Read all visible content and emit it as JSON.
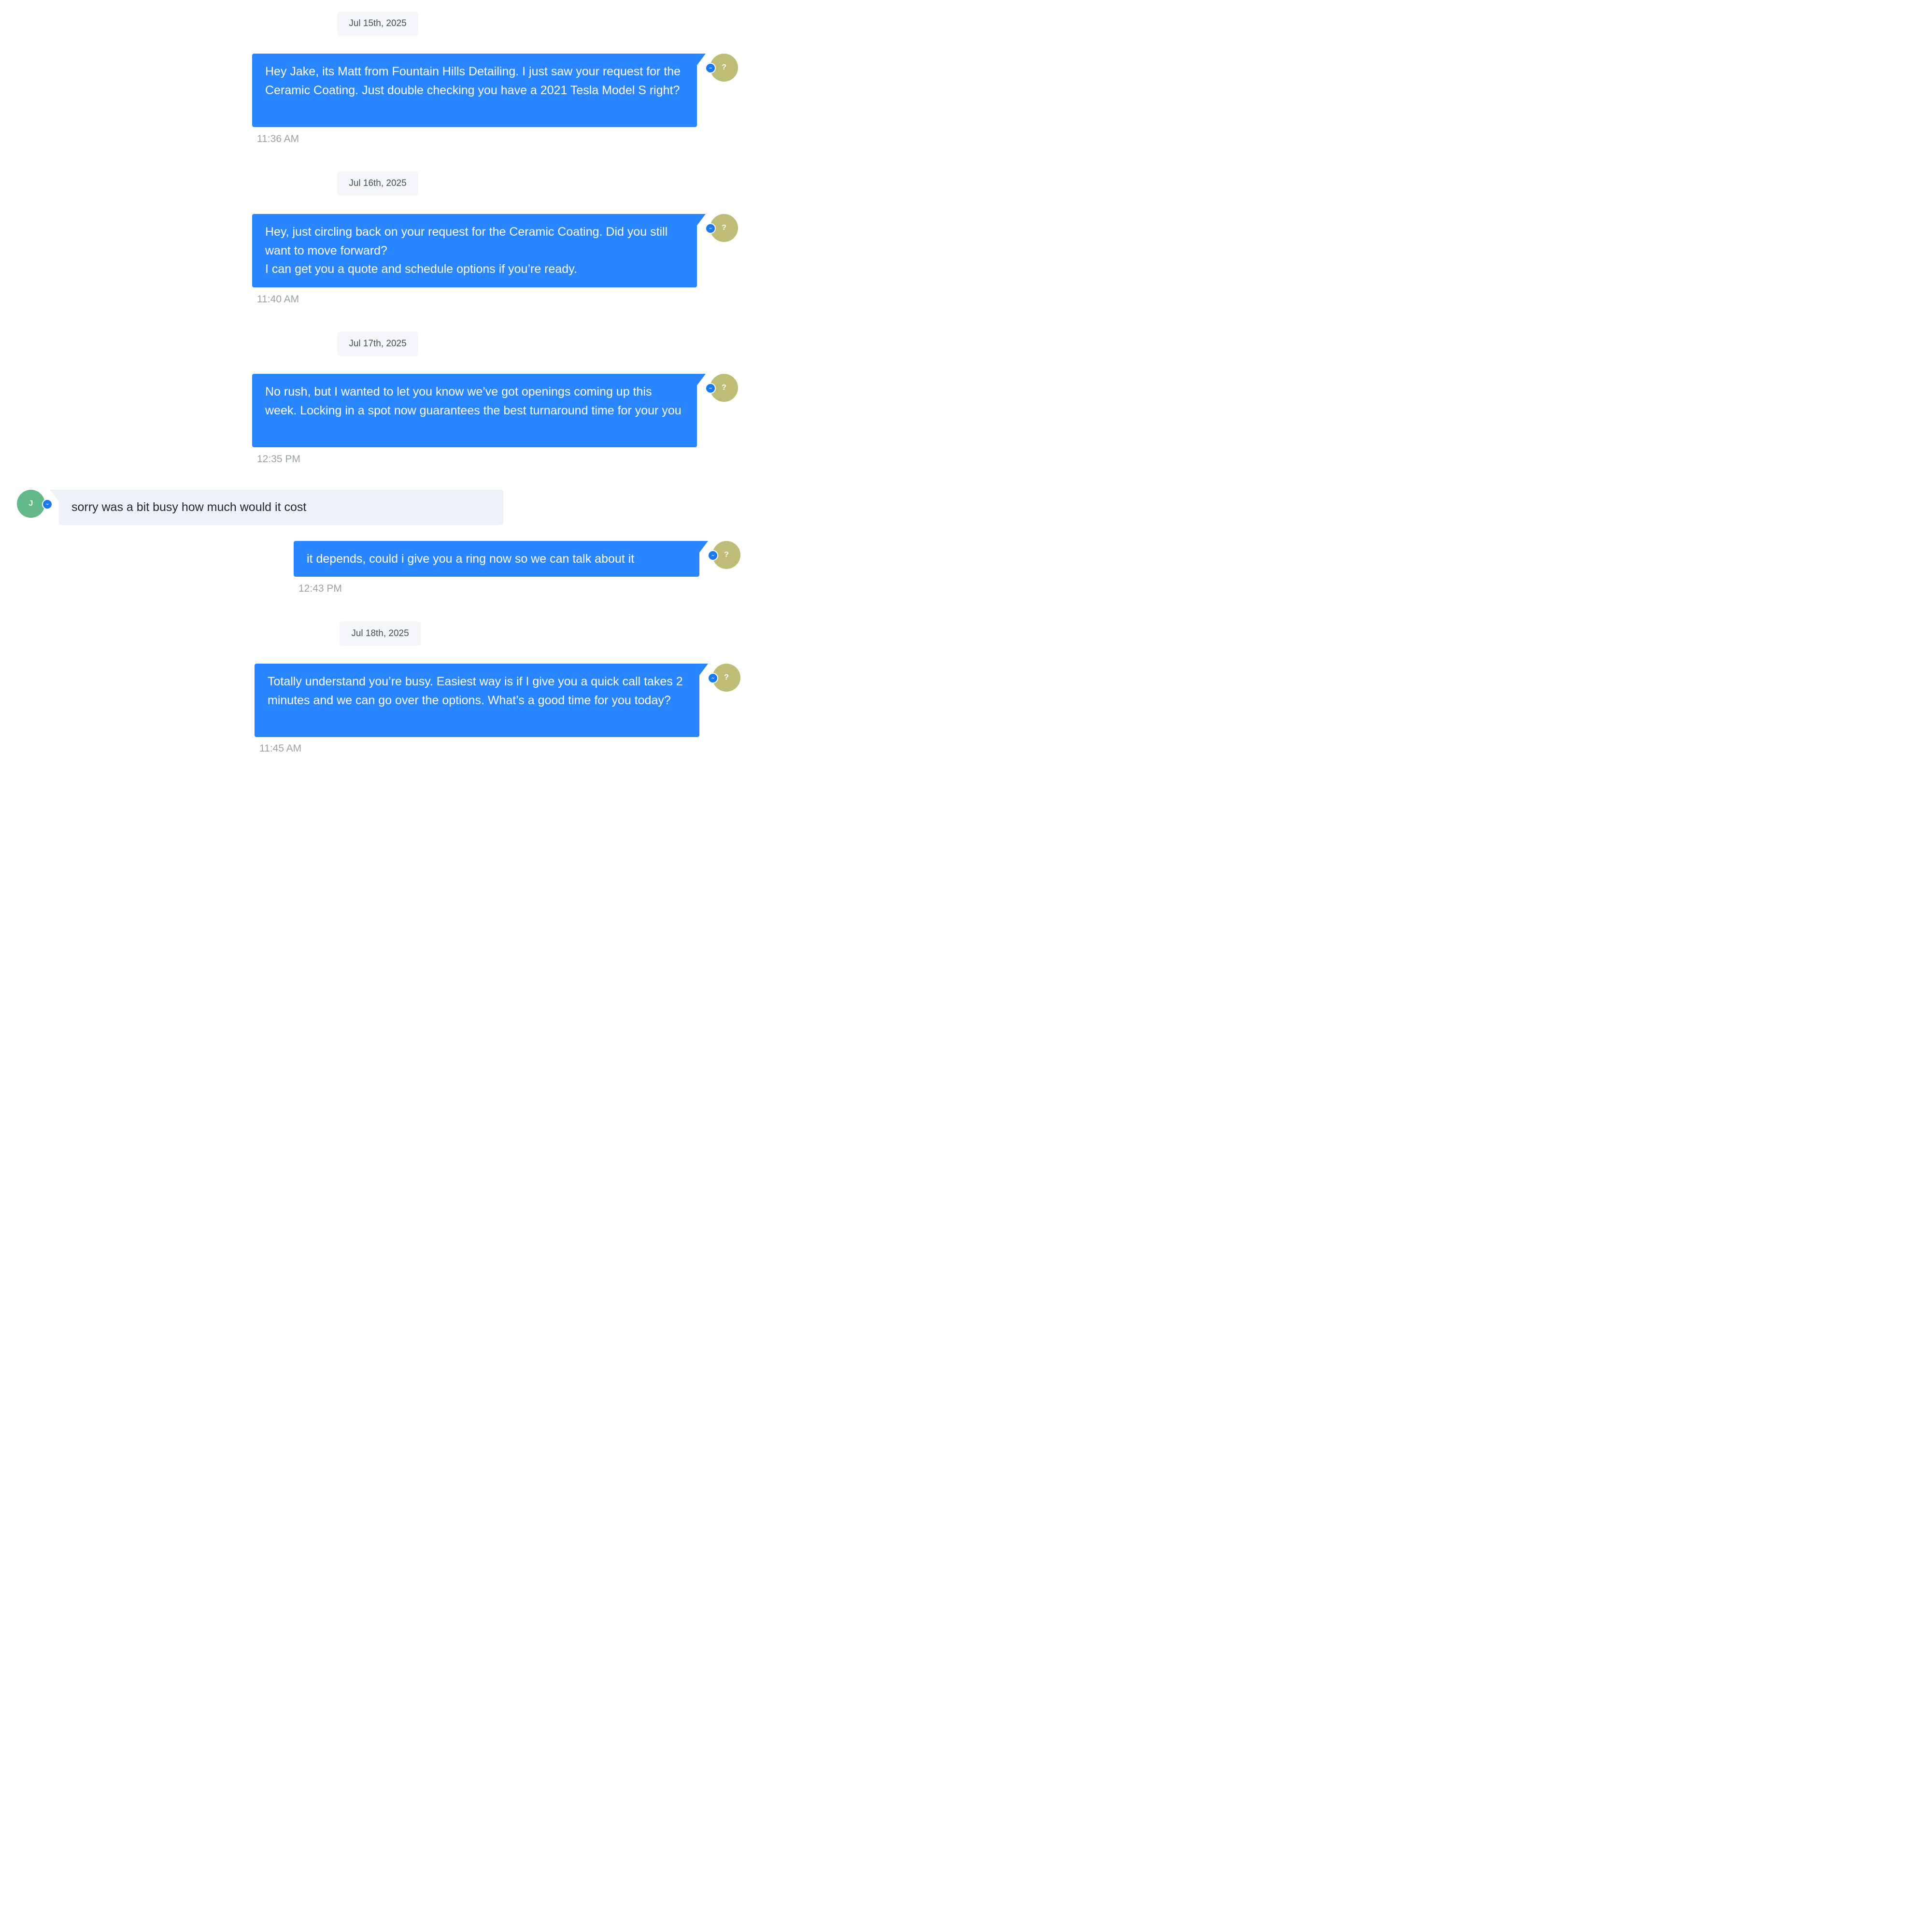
{
  "conversation": {
    "dates": [
      {
        "label": "Jul 15th, 2025"
      },
      {
        "label": "Jul 16th, 2025"
      },
      {
        "label": "Jul 17th, 2025"
      },
      {
        "label": "Jul 18th, 2025"
      }
    ],
    "messages": [
      {
        "direction": "outbound",
        "text": "Hey Jake, its Matt from Fountain Hills Detailing. I just saw your request for the Ceramic Coating. Just double checking you have a 2021 Tesla Model S right?",
        "time": "11:36 AM",
        "avatar": "?",
        "channel": "messenger-icon"
      },
      {
        "direction": "outbound",
        "text": "Hey, just circling back on your request for the Ceramic Coating. Did you still want to move forward?\nI can get you a quote and schedule options if you’re ready.",
        "time": "11:40 AM",
        "avatar": "?",
        "channel": "messenger-icon"
      },
      {
        "direction": "outbound",
        "text": "No rush, but I wanted to let you know we’ve got openings coming up this week. Locking in a spot now guarantees the best turnaround time for your you",
        "time": "12:35 PM",
        "avatar": "?",
        "channel": "messenger-icon"
      },
      {
        "direction": "inbound",
        "text": "sorry was a bit busy how much would it cost",
        "avatar": "J",
        "channel": "messenger-icon"
      },
      {
        "direction": "outbound",
        "text": "it depends, could i give you a ring now so we can talk about it",
        "time": "12:43 PM",
        "avatar": "?",
        "channel": "messenger-icon"
      },
      {
        "direction": "outbound",
        "text": "Totally understand you’re busy. Easiest way is if I give you a quick call takes 2 minutes and we can go over the options. What’s a good time for you today?",
        "time": "11:45 AM",
        "avatar": "?",
        "channel": "messenger-icon"
      }
    ]
  },
  "colors": {
    "outbound_bubble": "#2a86ff",
    "inbound_bubble": "#eef1f8",
    "agent_avatar": "#bdbd77",
    "contact_avatar": "#64b98a",
    "channel_badge": "#1a78f2"
  }
}
